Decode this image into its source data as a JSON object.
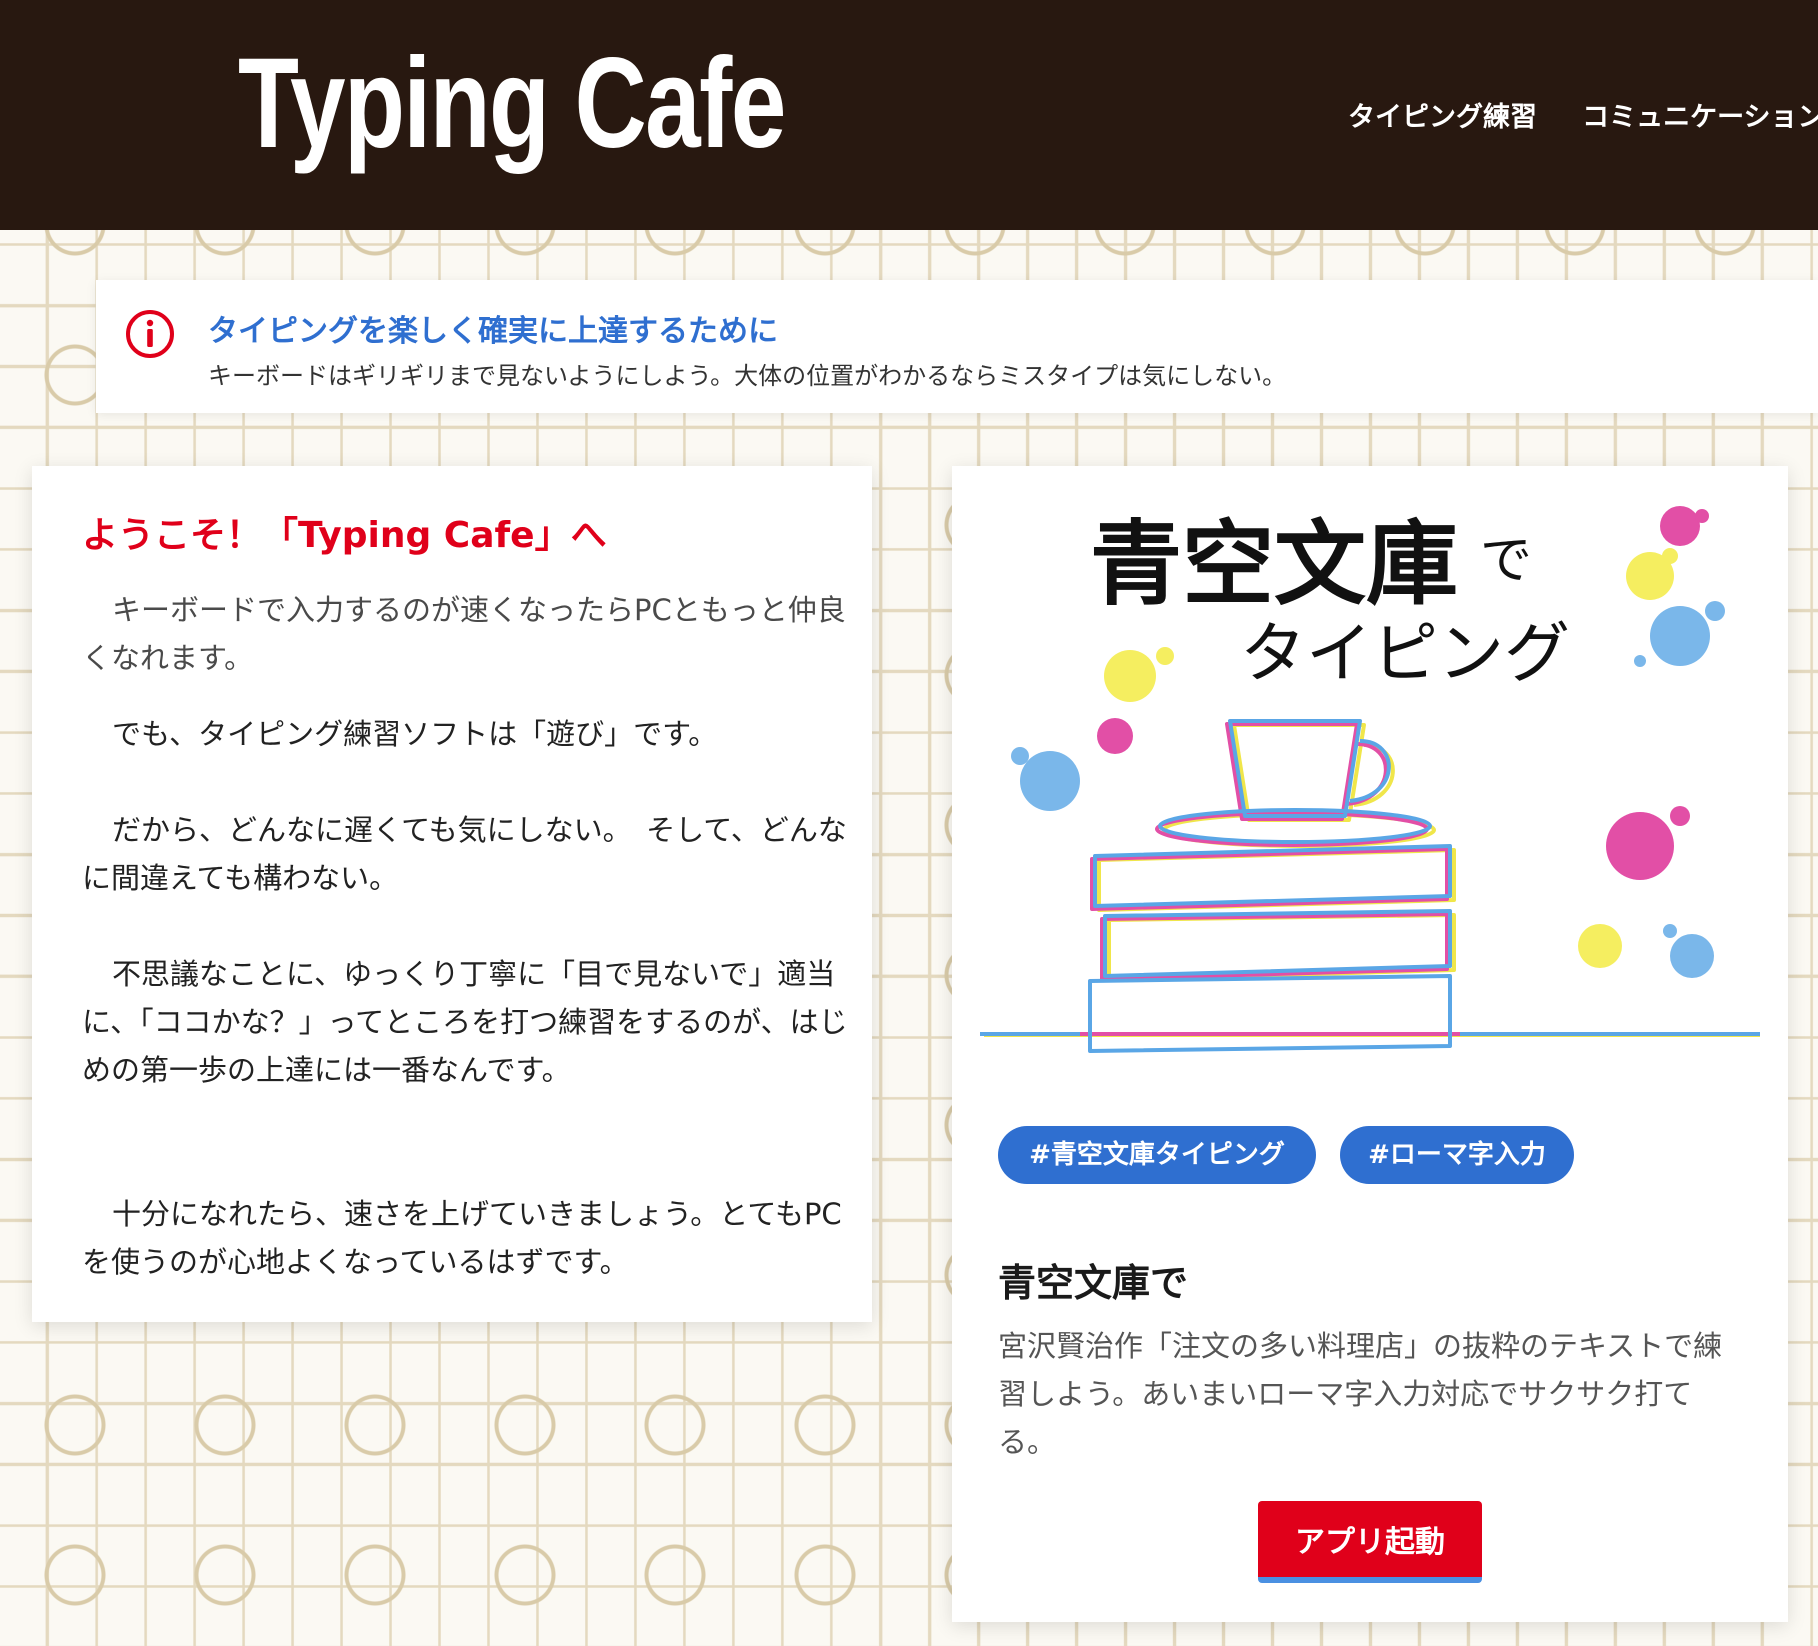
{
  "header": {
    "logo": "Typing Cafe",
    "nav": [
      "タイピング練習",
      "コミュニケーション"
    ]
  },
  "notice": {
    "icon": "info-icon",
    "title": "タイピングを楽しく確実に上達するために",
    "body": "キーボードはギリギリまで見ないようにしよう。大体の位置がわかるならミスタイプは気にしない。"
  },
  "welcome": {
    "title": "ようこそ！「Typing Cafe」へ",
    "paragraphs": [
      "キーボードで入力するのが速くなったらPCともっと仲良くなれます。",
      "でも、タイピング練習ソフトは「遊び」です。",
      "だから、どんなに遅くても気にしない。　そして、どんなに間違えても構わない。",
      "不思議なことに、ゆっくり丁寧に「目で見ないで」適当に、「ココかな？」ってところを打つ練習をするのが、はじめの第一歩の上達には一番なんです。",
      "十分になれたら、速さを上げていきましょう。とてもPCを使うのが心地よくなっているはずです。"
    ]
  },
  "app_card": {
    "art": {
      "line1": "青空文庫",
      "line1_small": "で",
      "line2": "タイピング"
    },
    "tags": [
      "#青空文庫タイピング",
      "#ローマ字入力"
    ],
    "title": "青空文庫で",
    "description": "宮沢賢治作「注文の多い料理店」の抜粋のテキストで練習しよう。あいまいローマ字入力対応でサクサク打てる。",
    "button": "アプリ起動"
  },
  "colors": {
    "header_bg": "#281810",
    "accent_red": "#e0001a",
    "accent_blue": "#2f6fd0"
  }
}
